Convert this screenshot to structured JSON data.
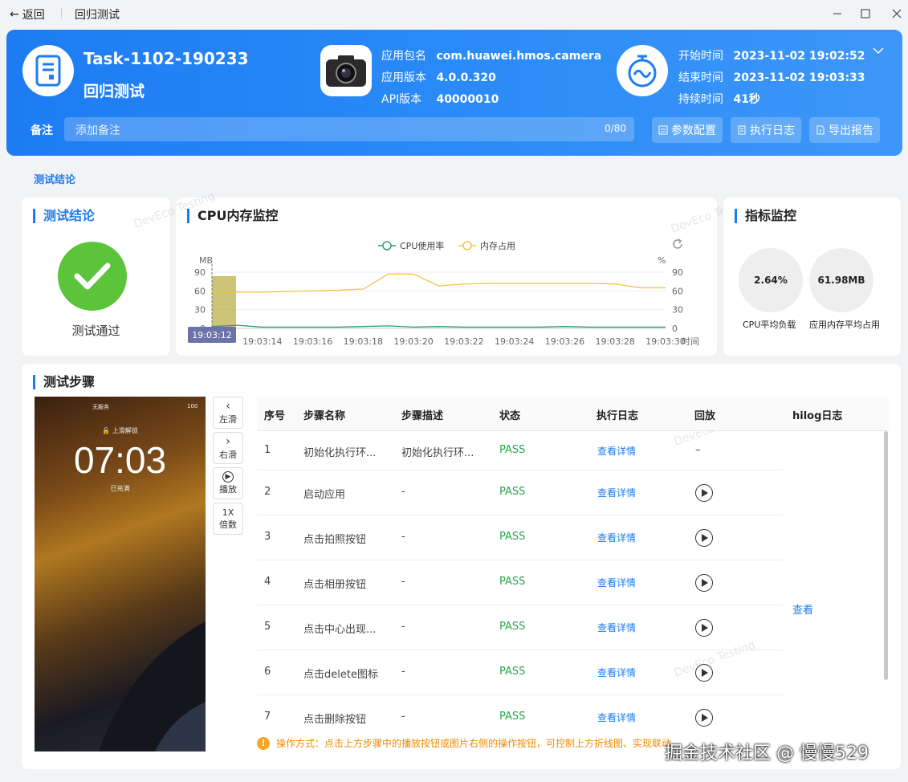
{
  "titlebar": {
    "back_label": "返回",
    "title": "回归测试"
  },
  "header": {
    "task_id": "Task-1102-190233",
    "task_name": "回归测试",
    "package_label": "应用包名",
    "package_value": "com.huawei.hmos.camera",
    "version_label": "应用版本",
    "version_value": "4.0.0.320",
    "api_label": "API版本",
    "api_value": "40000010",
    "start_label": "开始时间",
    "start_value": "2023-11-02 19:02:52",
    "end_label": "结束时间",
    "end_value": "2023-11-02 19:03:33",
    "duration_label": "持续时间",
    "duration_value": "41秒",
    "note_label": "备注",
    "note_placeholder": "添加备注",
    "note_count": "0/80",
    "btn_params": "参数配置",
    "btn_log": "执行日志",
    "btn_export": "导出报告"
  },
  "section_tab": "测试结论",
  "conclusion": {
    "title": "测试结论",
    "result": "测试通过"
  },
  "monitor": {
    "title": "CPU内存监控",
    "watermark": "DevEco Testing"
  },
  "metrics": {
    "title": "指标监控",
    "cpu_value": "2.64%",
    "cpu_label": "CPU平均负载",
    "mem_value": "61.98MB",
    "mem_label": "应用内存平均占用"
  },
  "chart_data": {
    "type": "line",
    "title": "CPU内存监控",
    "left_axis_unit": "MB",
    "right_axis_unit": "%",
    "x_axis_label": "时间",
    "x": [
      "19:03:12",
      "19:03:13",
      "19:03:14",
      "19:03:15",
      "19:03:16",
      "19:03:17",
      "19:03:18",
      "19:03:19",
      "19:03:20",
      "19:03:21",
      "19:03:22",
      "19:03:23",
      "19:03:24",
      "19:03:25",
      "19:03:26",
      "19:03:27",
      "19:03:28",
      "19:03:29",
      "19:03:30"
    ],
    "x_tick_labels": [
      "19:03:12",
      "19:03:14",
      "19:03:16",
      "19:03:18",
      "19:03:20",
      "19:03:22",
      "19:03:24",
      "19:03:26",
      "19:03:28",
      "19:03:30"
    ],
    "left_ticks": [
      0,
      30,
      60,
      90
    ],
    "right_ticks": [
      0,
      30,
      60,
      90
    ],
    "ylim": [
      0,
      90
    ],
    "series": [
      {
        "name": "CPU使用率",
        "color": "#2e9e6e",
        "values": [
          3,
          5,
          2,
          2,
          2,
          2,
          3,
          4,
          2,
          3,
          2,
          2,
          2,
          2,
          3,
          2,
          2,
          2,
          2
        ]
      },
      {
        "name": "内存占用",
        "color": "#f5c343",
        "values": [
          58,
          58,
          58,
          59,
          60,
          61,
          63,
          87,
          87,
          68,
          71,
          72,
          72,
          72,
          72,
          72,
          71,
          65,
          65
        ]
      }
    ],
    "highlight_label": "19:03:12",
    "legend_position": "top-center"
  },
  "steps": {
    "title": "测试步骤",
    "phone": {
      "carrier": "无服务",
      "unlock_text": "上滑解锁",
      "time": "07:03",
      "charge": "已充满",
      "battery": "100"
    },
    "controls": [
      {
        "icon": "‹",
        "label": "左滑"
      },
      {
        "icon": "›",
        "label": "右滑"
      },
      {
        "icon": "▶",
        "label": "播放"
      },
      {
        "icon": "1X",
        "label": "倍数"
      }
    ],
    "columns": [
      "序号",
      "步骤名称",
      "步骤描述",
      "状态",
      "执行日志",
      "回放",
      "hilog日志"
    ],
    "rows": [
      {
        "no": "1",
        "name": "初始化执行环...",
        "desc": "初始化执行环...",
        "status": "PASS",
        "log": "查看详情",
        "replay": "–"
      },
      {
        "no": "2",
        "name": "启动应用",
        "desc": "-",
        "status": "PASS",
        "log": "查看详情",
        "replay": ""
      },
      {
        "no": "3",
        "name": "点击拍照按钮",
        "desc": "-",
        "status": "PASS",
        "log": "查看详情",
        "replay": ""
      },
      {
        "no": "4",
        "name": "点击相册按钮",
        "desc": "-",
        "status": "PASS",
        "log": "查看详情",
        "replay": ""
      },
      {
        "no": "5",
        "name": "点击中心出现...",
        "desc": "-",
        "status": "PASS",
        "log": "查看详情",
        "replay": ""
      },
      {
        "no": "6",
        "name": "点击delete图标",
        "desc": "-",
        "status": "PASS",
        "log": "查看详情",
        "replay": ""
      },
      {
        "no": "7",
        "name": "点击删除按钮",
        "desc": "-",
        "status": "PASS",
        "log": "查看详情",
        "replay": ""
      }
    ],
    "hilog_link": "查看",
    "tip": "操作方式：点击上方步骤中的播放按钮或图片右侧的操作按钮，可控制上方折线图、实现联动"
  },
  "credit": "掘金技术社区 @ 慢慢529"
}
